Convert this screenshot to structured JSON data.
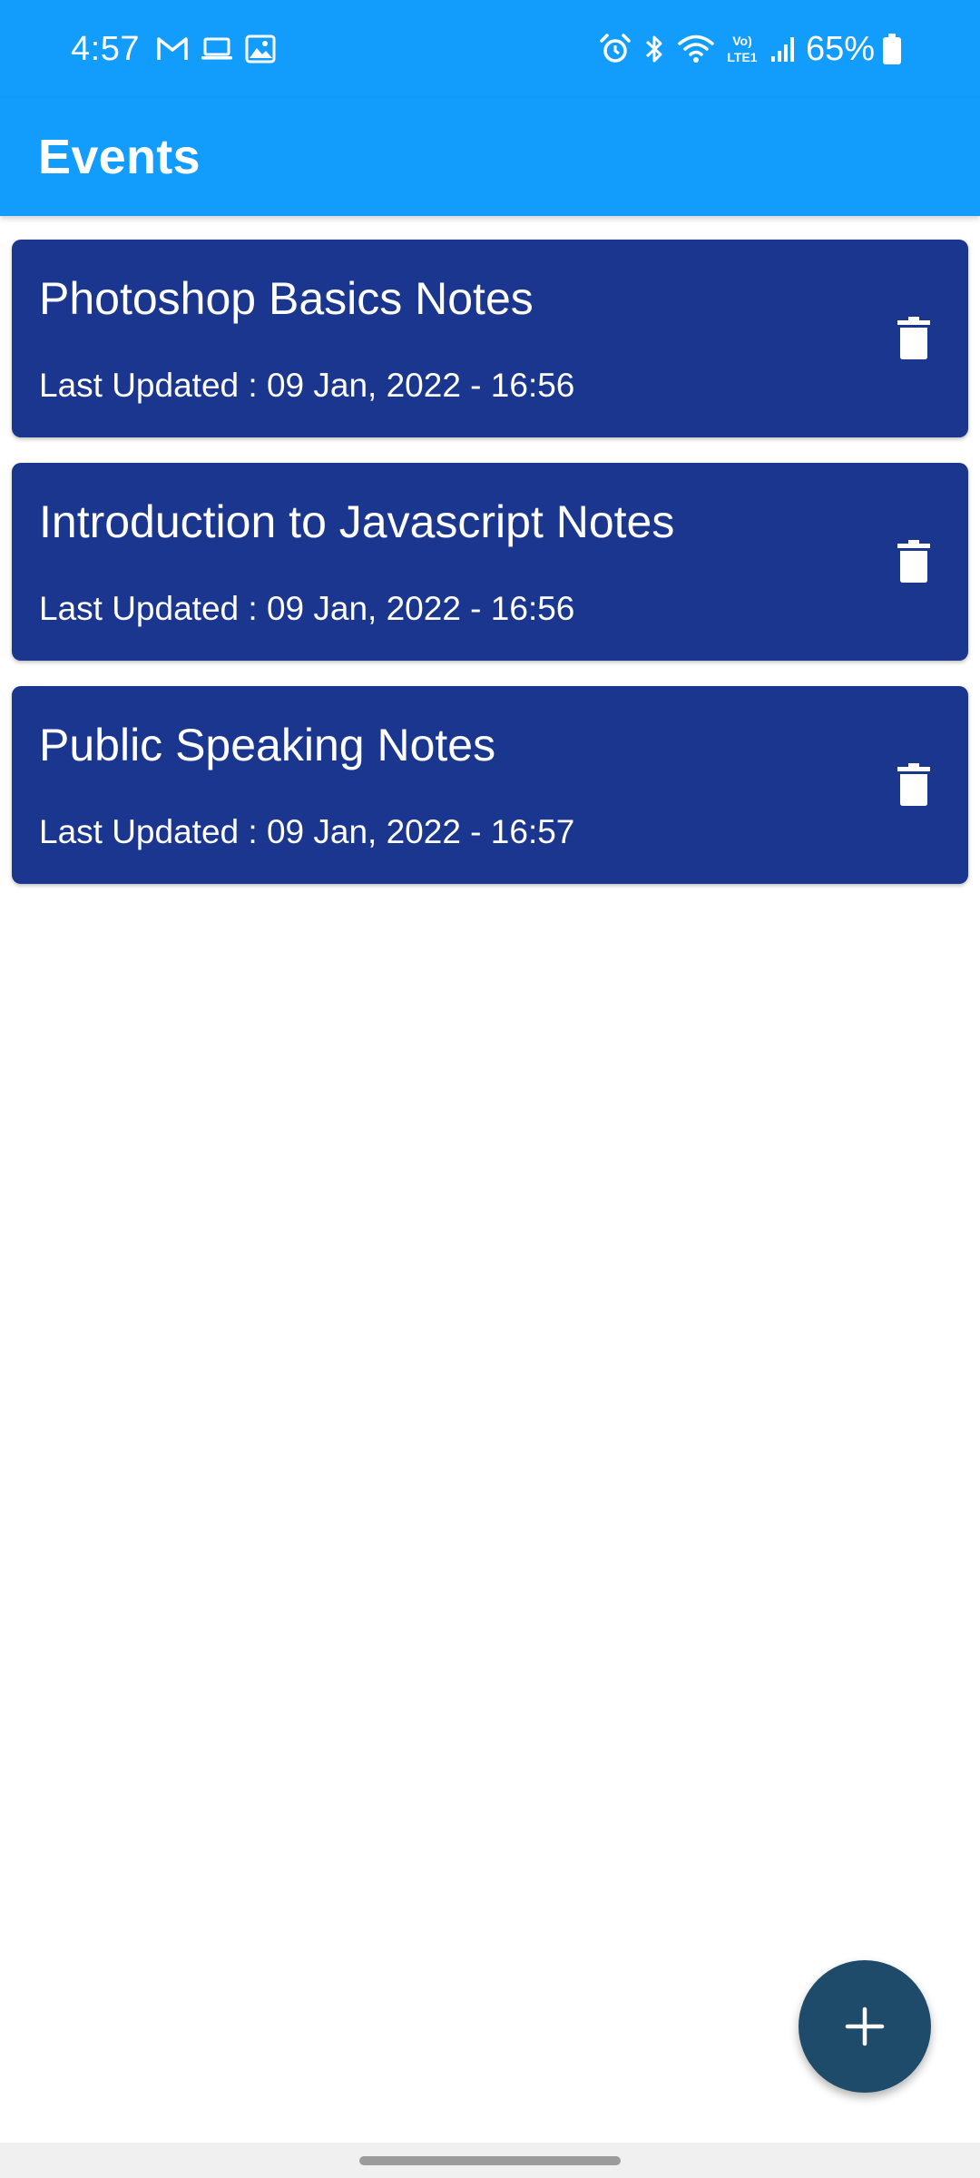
{
  "status_bar": {
    "time": "4:57",
    "battery": "65%",
    "network_label": "Vo) LTE1",
    "left_icons": [
      "gmail-icon",
      "laptop-icon",
      "image-icon"
    ],
    "right_icons": [
      "alarm-icon",
      "bluetooth-icon",
      "wifi-icon",
      "lte-icon",
      "signal-icon",
      "battery-icon"
    ]
  },
  "app_bar": {
    "title": "Events"
  },
  "events": [
    {
      "title": "Photoshop Basics Notes",
      "subtitle": "Last Updated : 09 Jan, 2022 - 16:56"
    },
    {
      "title": "Introduction to Javascript Notes",
      "subtitle": "Last Updated : 09 Jan, 2022 - 16:56"
    },
    {
      "title": "Public Speaking Notes",
      "subtitle": "Last Updated : 09 Jan, 2022 - 16:57"
    }
  ],
  "icons": {
    "delete": "delete-icon",
    "fab": "plus-icon"
  },
  "colors": {
    "primary": "#129CFC",
    "card": "#1A368E",
    "fab": "#1E4B6A",
    "text_on_primary": "#FFFFFF"
  }
}
